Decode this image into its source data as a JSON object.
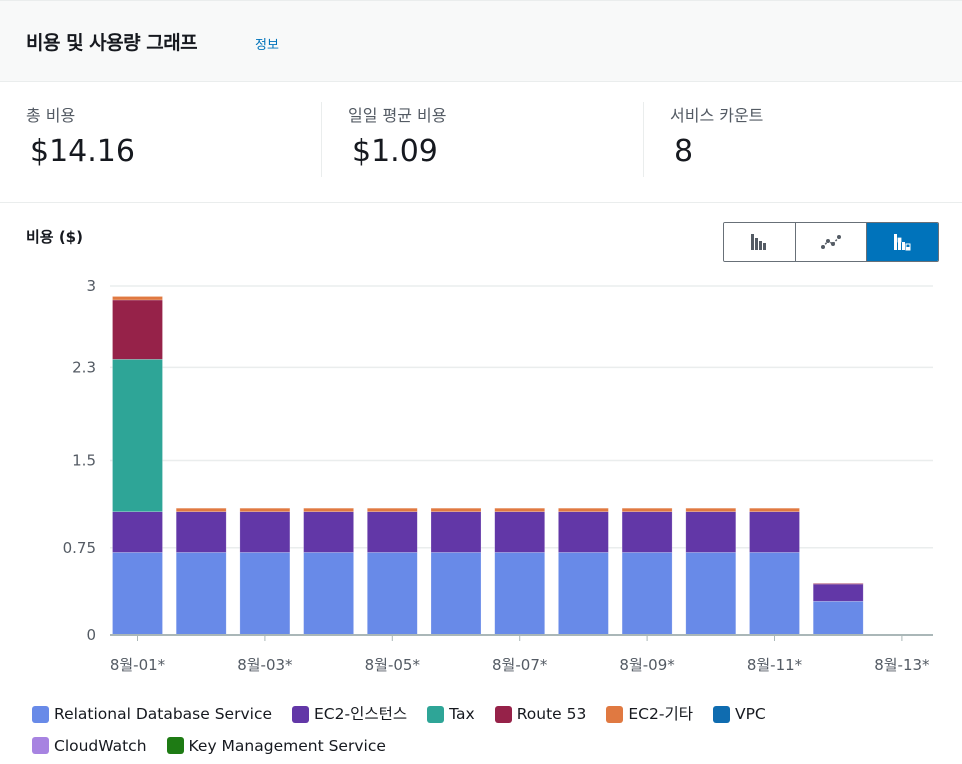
{
  "header": {
    "title": "비용 및 사용량 그래프",
    "info_link": "정보"
  },
  "stats": [
    {
      "label": "총 비용",
      "value": "$14.16"
    },
    {
      "label": "일일 평균 비용",
      "value": "$1.09"
    },
    {
      "label": "서비스 카운트",
      "value": "8"
    }
  ],
  "chart_toggle": {
    "options": [
      {
        "name": "bar-chart",
        "icon": "bar-chart-icon",
        "active": false
      },
      {
        "name": "line-chart",
        "icon": "line-chart-icon",
        "active": false
      },
      {
        "name": "stacked-bar-chart",
        "icon": "stacked-bar-chart-icon",
        "active": true
      }
    ]
  },
  "colors": {
    "gridline": "#eaeded",
    "axis": "#aab7b8",
    "tick_text": "#545b64",
    "accent": "#0073bb"
  },
  "chart_data": {
    "type": "bar",
    "stacked": true,
    "title": "",
    "ylabel": "비용 ($)",
    "xlabel": "",
    "ylim": [
      0,
      3
    ],
    "yticks": [
      0,
      0.75,
      1.5,
      2.3,
      3
    ],
    "ytick_labels": [
      "0",
      "0.75",
      "1.5",
      "2.3",
      "3"
    ],
    "grid": true,
    "legend_position": "bottom",
    "categories": [
      "8월-01*",
      "8월-02*",
      "8월-03*",
      "8월-04*",
      "8월-05*",
      "8월-06*",
      "8월-07*",
      "8월-08*",
      "8월-09*",
      "8월-10*",
      "8월-11*",
      "8월-12*",
      "8월-13*"
    ],
    "xtick_labels": [
      "8월-01*",
      "8월-03*",
      "8월-05*",
      "8월-07*",
      "8월-09*",
      "8월-11*",
      "8월-13*"
    ],
    "xtick_indices": [
      0,
      2,
      4,
      6,
      8,
      10,
      12
    ],
    "series": [
      {
        "name": "Relational Database Service",
        "color": "#688ae8",
        "values": [
          0.71,
          0.71,
          0.71,
          0.71,
          0.71,
          0.71,
          0.71,
          0.71,
          0.71,
          0.71,
          0.71,
          0.29,
          0
        ]
      },
      {
        "name": "EC2-인스턴스",
        "color": "#6237a7",
        "values": [
          0.35,
          0.35,
          0.35,
          0.35,
          0.35,
          0.35,
          0.35,
          0.35,
          0.35,
          0.35,
          0.35,
          0.15,
          0
        ]
      },
      {
        "name": "Tax",
        "color": "#2ea597",
        "values": [
          1.31,
          0,
          0,
          0,
          0,
          0,
          0,
          0,
          0,
          0,
          0,
          0,
          0
        ]
      },
      {
        "name": "Route 53",
        "color": "#962249",
        "values": [
          0.51,
          0,
          0,
          0,
          0,
          0,
          0,
          0,
          0,
          0,
          0,
          0.003,
          0
        ]
      },
      {
        "name": "EC2-기타",
        "color": "#e07941",
        "values": [
          0.03,
          0.03,
          0.03,
          0.03,
          0.03,
          0.03,
          0.03,
          0.03,
          0.03,
          0.03,
          0.03,
          0,
          0
        ]
      },
      {
        "name": "VPC",
        "color": "#0f6cb0",
        "values": [
          0,
          0,
          0,
          0,
          0,
          0,
          0,
          0,
          0,
          0,
          0,
          0,
          0
        ]
      },
      {
        "name": "CloudWatch",
        "color": "#a783e1",
        "values": [
          0,
          0,
          0,
          0,
          0,
          0,
          0,
          0,
          0,
          0,
          0,
          0,
          0
        ]
      },
      {
        "name": "Key Management Service",
        "color": "#1e7b14",
        "values": [
          0,
          0,
          0,
          0,
          0,
          0,
          0,
          0,
          0,
          0,
          0,
          0,
          0
        ]
      }
    ]
  }
}
